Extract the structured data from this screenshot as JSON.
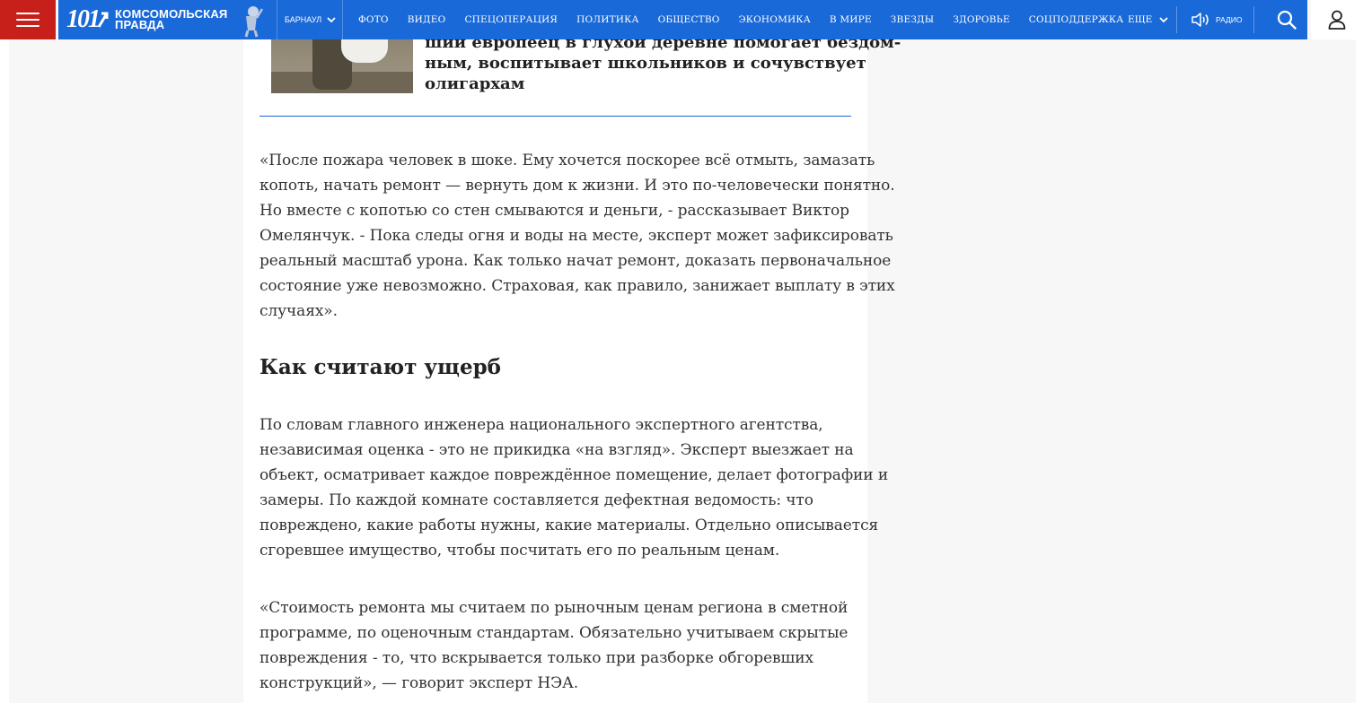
{
  "header": {
    "logo": {
      "number": "101",
      "brand_line1": "КОМСОМОЛЬСКАЯ",
      "brand_line2": "ПРАВДА"
    },
    "city": "БАРНАУЛ",
    "nav": [
      {
        "label": "ФОТО"
      },
      {
        "label": "ВИДЕО"
      },
      {
        "label": "СПЕЦОПЕРАЦИЯ"
      },
      {
        "label": "ПОЛИТИКА"
      },
      {
        "label": "ОБЩЕСТВО"
      },
      {
        "label": "ЭКОНОМИКА"
      },
      {
        "label": "В МИРЕ"
      },
      {
        "label": "ЗВЕЗДЫ"
      },
      {
        "label": "ЗДОРОВЬЕ"
      },
      {
        "label": "СОЦПОДДЕРЖКА"
      }
    ],
    "more_label": "ЕЩЕ",
    "radio_label": "РАДИО",
    "colors": {
      "brand_blue": "#1a69d8",
      "brand_red": "#c7201a"
    }
  },
  "related": {
    "title_lines": [
      "ший европеец в глухой деревне помогает бездом-",
      "ным, воспитывает школьников и сочувствует",
      "олигархам"
    ]
  },
  "article": {
    "para1_lines": [
      "«После пожара человек в шоке. Ему хочется поскорее всё отмыть, замазать",
      "копоть, начать ремонт — вернуть дом к жизни. И это по-человечески понятно.",
      "Но вместе с копотью со стен смываются и деньги, - рассказывает Виктор",
      "Омелянчук. - Пока следы огня и воды на месте, эксперт может зафиксировать",
      "реальный масштаб урона. Как только начат ремонт, доказать первоначальное",
      "состояние уже невозможно. Страховая, как правило, занижает выплату в этих",
      "случаях»."
    ],
    "heading": "Как считают ущерб",
    "para2_lines": [
      "По словам главного инженера национального экспертного агентства,",
      "независимая оценка - это не прикидка «на взгляд». Эксперт выезжает на",
      "объект, осматривает каждое повреждённое помещение, делает фотографии и",
      "замеры. По каждой комнате составляется дефектная ведомость: что",
      "повреждено, какие работы нужны, какие материалы. Отдельно описывается",
      "сгоревшее имущество, чтобы посчитать его по реальным ценам."
    ],
    "para3_lines": [
      "«Стоимость ремонта мы считаем по рыночным ценам региона в сметной",
      "программе, по оценочным стандартам. Обязательно учитываем скрытые",
      "повреждения - то, что вскрывается только при разборке обгоревших",
      "конструкций», — говорит эксперт НЭА."
    ]
  }
}
